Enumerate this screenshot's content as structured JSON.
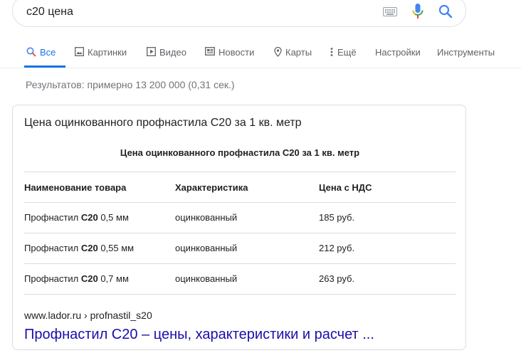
{
  "search": {
    "query": "с20 цена"
  },
  "tabs": [
    {
      "label": "Все",
      "icon": "search-icon"
    },
    {
      "label": "Картинки",
      "icon": "image-icon"
    },
    {
      "label": "Видео",
      "icon": "video-play-icon"
    },
    {
      "label": "Новости",
      "icon": "news-icon"
    },
    {
      "label": "Карты",
      "icon": "map-pin-icon"
    },
    {
      "label": "Ещё",
      "icon": "more-vert-icon"
    },
    {
      "label": "Настройки"
    },
    {
      "label": "Инструменты"
    }
  ],
  "stats": "Результатов: примерно 13 200 000 (0,31 сек.)",
  "snippet": {
    "heading": "Цена оцинкованного профнастила С20 за 1 кв. метр",
    "table_caption": "Цена оцинкованного профнастила С20 за 1 кв. метр",
    "columns": [
      "Наименование товара",
      "Характеристика",
      "Цена с НДС"
    ],
    "rows": [
      {
        "name_prefix": "Профнастил",
        "name_bold": "С20",
        "name_suffix": "0,5 мм",
        "characteristic": "оцинкованный",
        "price": "185 руб."
      },
      {
        "name_prefix": "Профнастил",
        "name_bold": "С20",
        "name_suffix": "0,55 мм",
        "characteristic": "оцинкованный",
        "price": "212 руб."
      },
      {
        "name_prefix": "Профнастил",
        "name_bold": "С20",
        "name_suffix": "0,7 мм",
        "characteristic": "оцинкованный",
        "price": "263 руб."
      }
    ],
    "cite": "www.lador.ru › profnastil_s20",
    "title": "Профнастил С20 – цены, характеристики и расчет ..."
  },
  "colors": {
    "link": "#1a0dab",
    "accent": "#1a73e8",
    "muted": "#70757a"
  }
}
